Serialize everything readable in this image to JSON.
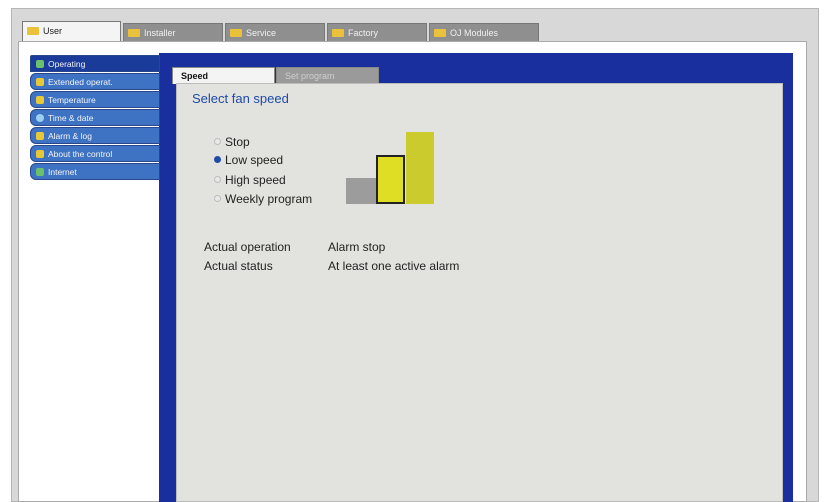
{
  "top_tabs": [
    {
      "label": "User",
      "active": true
    },
    {
      "label": "Installer",
      "active": false
    },
    {
      "label": "Service",
      "active": false
    },
    {
      "label": "Factory",
      "active": false
    },
    {
      "label": "OJ Modules",
      "active": false
    }
  ],
  "menu": [
    {
      "label": "Operating",
      "icon": "fan-icon",
      "active": true
    },
    {
      "label": "Extended operat.",
      "icon": "fan-icon",
      "active": false
    },
    {
      "label": "Temperature",
      "icon": "thermometer-icon",
      "active": false
    },
    {
      "label": "Time & date",
      "icon": "clock-icon",
      "active": false
    },
    {
      "label": "Alarm & log",
      "icon": "bell-icon",
      "active": false
    },
    {
      "label": "About the control",
      "icon": "help-icon",
      "active": false
    },
    {
      "label": "Internet",
      "icon": "globe-icon",
      "active": false
    }
  ],
  "inner_tabs": {
    "speed": "Speed",
    "program": "Set program"
  },
  "speed_panel": {
    "title": "Select fan speed",
    "options": [
      "Stop",
      "Low speed",
      "High speed",
      "Weekly program"
    ],
    "selected": "Low speed",
    "actual_operation_label": "Actual operation",
    "actual_operation_value": "Alarm stop",
    "actual_status_label": "Actual status",
    "actual_status_value": "At least one active alarm"
  },
  "colors": {
    "accent_blue": "#1a2f9e",
    "menu_blue": "#3e73c4",
    "speed_bar_yellow": "#e0de24",
    "speed_bar_high": "#cbcb2e"
  }
}
